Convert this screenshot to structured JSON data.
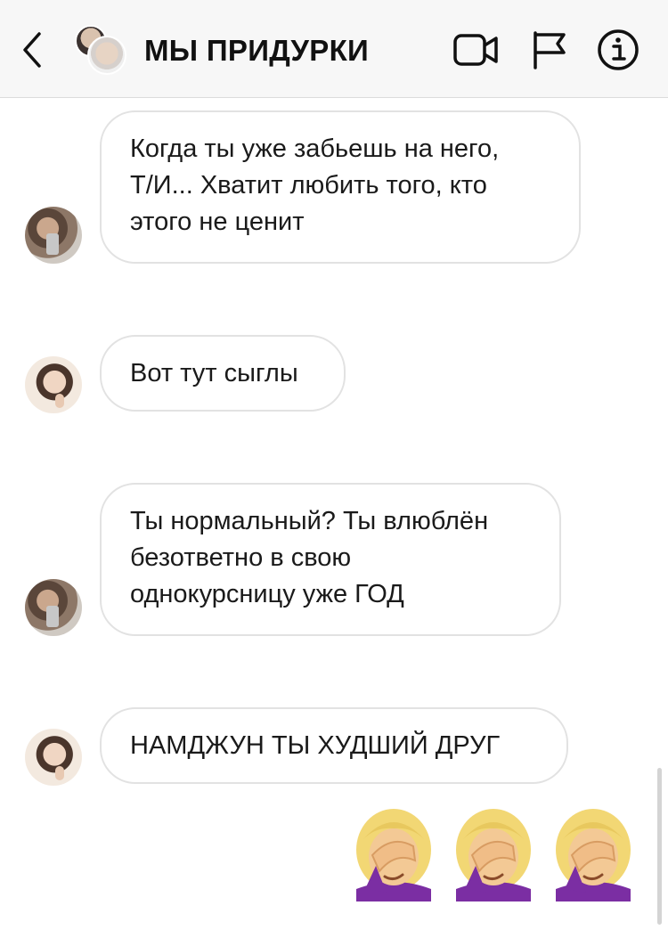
{
  "header": {
    "title": "МЫ ПРИДУРКИ",
    "icons": [
      "back-chevron-icon",
      "video-camera-icon",
      "flag-icon",
      "info-icon"
    ]
  },
  "messages": [
    {
      "sender_avatar": "namjoon-avatar",
      "lines": [
        "Когда ты уже забьешь на него,",
        "Т/И... Хватит любить того, кто",
        "этого не ценит"
      ]
    },
    {
      "sender_avatar": "jin-avatar",
      "lines": [
        "Вот тут сыглы"
      ]
    },
    {
      "sender_avatar": "namjoon-avatar",
      "lines": [
        "Ты нормальный? Ты влюблён",
        "безответно в свою",
        "однокурсницу уже ГОД"
      ]
    },
    {
      "sender_avatar": "jin-avatar",
      "lines": [
        "НАМДЖУН ТЫ ХУДШИЙ ДРУГ"
      ]
    }
  ],
  "reaction": {
    "emoji": "woman-facepalming-icon",
    "count": 3
  },
  "colors": {
    "header_bg": "#f7f7f7",
    "bubble_border": "#e2e2e2",
    "emoji_hair": "#f2d774",
    "emoji_shirt": "#7b2ea3"
  }
}
